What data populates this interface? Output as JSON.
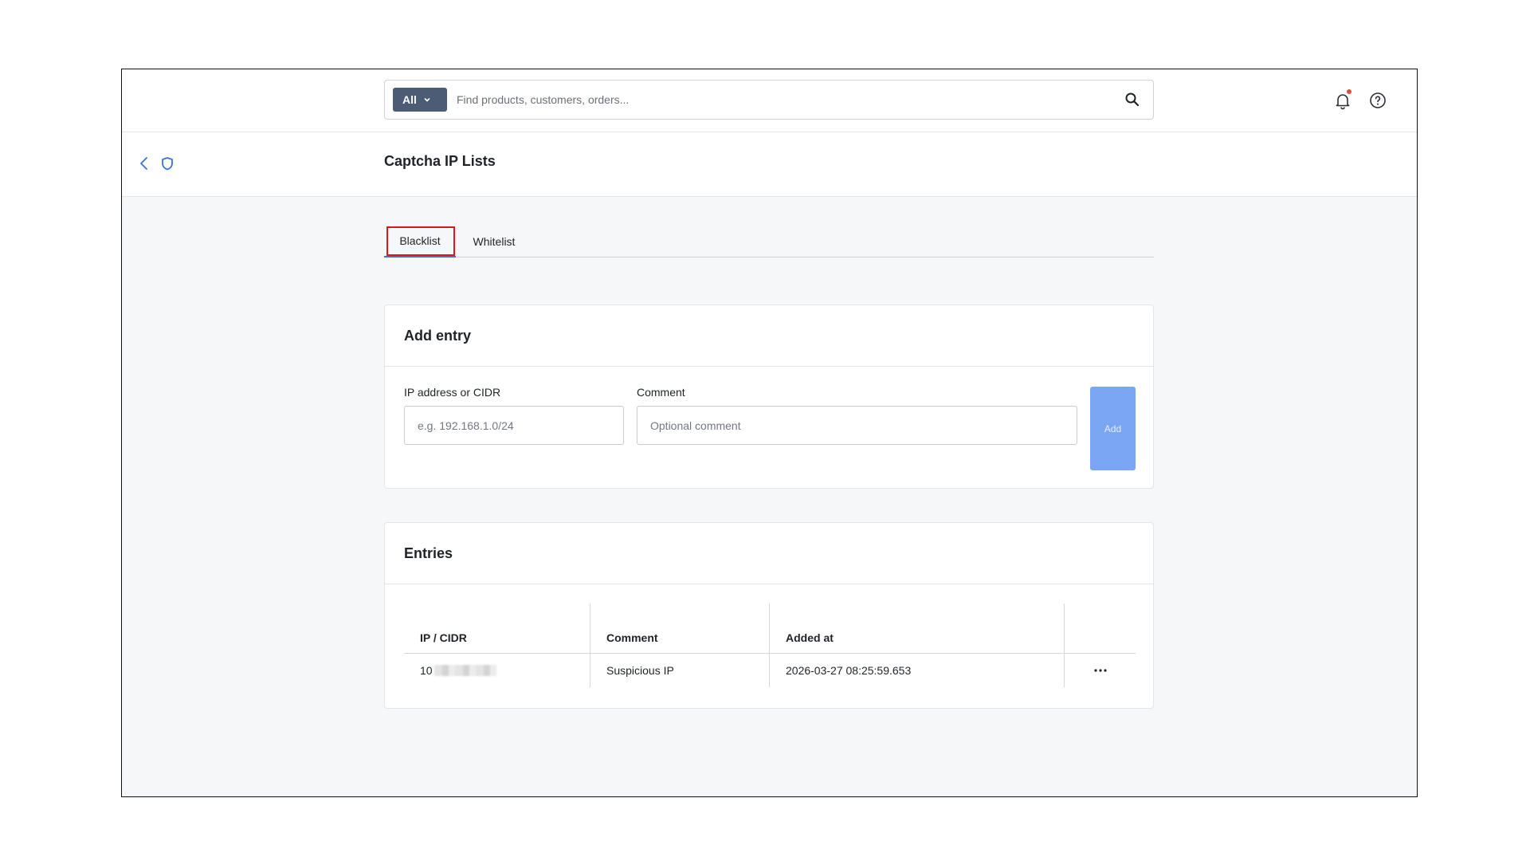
{
  "search": {
    "scope_label": "All",
    "placeholder": "Find products, customers, orders..."
  },
  "header": {
    "title": "Captcha IP Lists"
  },
  "tabs": [
    {
      "label": "Blacklist",
      "active": true
    },
    {
      "label": "Whitelist",
      "active": false
    }
  ],
  "add_entry": {
    "title": "Add entry",
    "ip_label": "IP address or CIDR",
    "ip_placeholder": "e.g. 192.168.1.0/24",
    "ip_value": "",
    "comment_label": "Comment",
    "comment_placeholder": "Optional comment",
    "comment_value": "",
    "add_button": "Add"
  },
  "entries": {
    "title": "Entries",
    "columns": [
      "IP / CIDR",
      "Comment",
      "Added at",
      ""
    ],
    "rows": [
      {
        "ip_visible": "10",
        "comment": "Suspicious IP",
        "added_at": "2026-03-27 08:25:59.653"
      }
    ]
  },
  "colors": {
    "accent": "#3b73d8",
    "add_button": "#7ba6f4",
    "scope_button": "#4b5c74",
    "notification_dot": "#e5483c",
    "focus_outline": "#e0141d"
  }
}
